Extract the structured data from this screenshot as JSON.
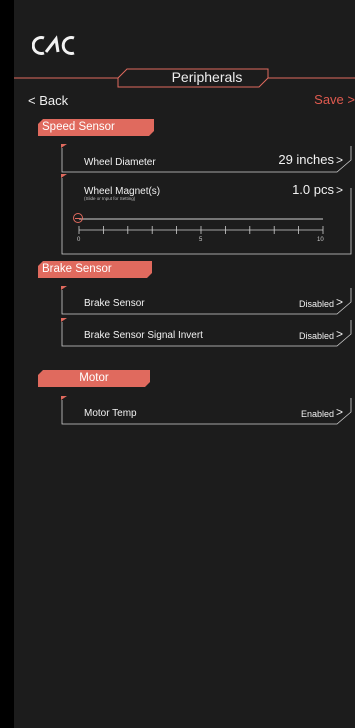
{
  "header": {
    "title": "Peripherals",
    "back_label": "< Back",
    "save_label": "Save >"
  },
  "sections": [
    {
      "title": "Speed Sensor"
    },
    {
      "title": "Brake Sensor"
    },
    {
      "title": "Motor"
    }
  ],
  "speed_sensor": {
    "wheel_diameter": {
      "label": "Wheel Diameter",
      "value": "29 inches",
      "arrow": ">"
    },
    "wheel_magnets": {
      "label": "Wheel Magnet(s)",
      "hint": "(Slide or Input for Setting)",
      "value": "1.0 pcs",
      "arrow": ">",
      "slider": {
        "min": 0,
        "max": 10,
        "value": 0,
        "tick_labels": [
          "0",
          "5",
          "10"
        ]
      }
    }
  },
  "brake_sensor": {
    "rows": [
      {
        "label": "Brake Sensor",
        "value": "Disabled",
        "arrow": ">"
      },
      {
        "label": "Brake Sensor Signal Invert",
        "value": "Disabled",
        "arrow": ">"
      }
    ]
  },
  "motor": {
    "rows": [
      {
        "label": "Motor Temp",
        "value": "Enabled",
        "arrow": ">"
      }
    ]
  },
  "colors": {
    "accent": "#e06a5e",
    "save": "#e05a4f",
    "background": "#1c1c1c",
    "outer": "#000000"
  },
  "icons": {
    "logo": "brand-logo-icon"
  }
}
